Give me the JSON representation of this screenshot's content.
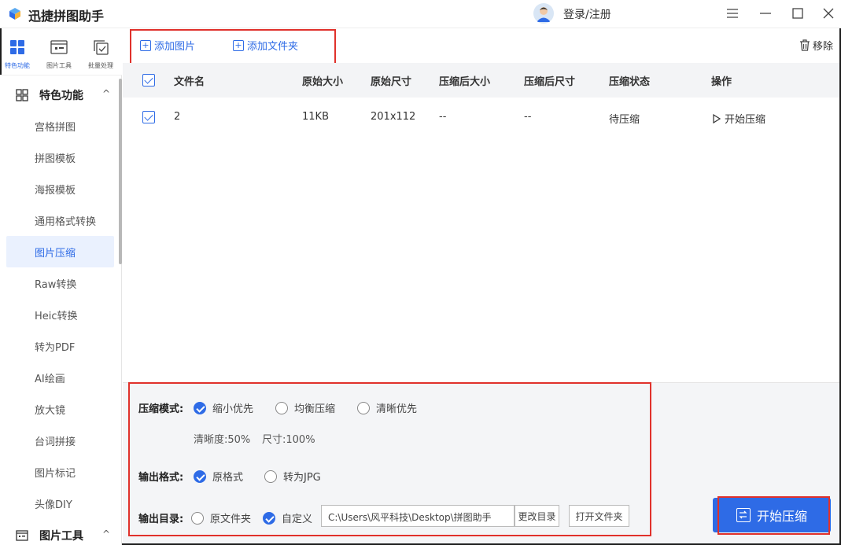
{
  "app": {
    "title": "迅捷拼图助手",
    "login": "登录/注册"
  },
  "topnav": [
    {
      "label": "特色功能",
      "icon": "grid-icon"
    },
    {
      "label": "图片工具",
      "icon": "image-tool-icon"
    },
    {
      "label": "批量处理",
      "icon": "batch-icon"
    }
  ],
  "sidebar": {
    "group1": "特色功能",
    "items": [
      "宫格拼图",
      "拼图模板",
      "海报模板",
      "通用格式转换",
      "图片压缩",
      "Raw转换",
      "Heic转换",
      "转为PDF",
      "AI绘画",
      "放大镜",
      "台词拼接",
      "图片标记",
      "头像DIY"
    ],
    "active_index": 4,
    "group2": "图片工具"
  },
  "toolbar": {
    "add_image": "添加图片",
    "add_folder": "添加文件夹",
    "remove": "移除"
  },
  "table": {
    "headers": [
      "文件名",
      "原始大小",
      "原始尺寸",
      "压缩后大小",
      "压缩后尺寸",
      "压缩状态",
      "操作"
    ],
    "rows": [
      {
        "name": "2",
        "size": "11KB",
        "dims": "201x112",
        "new_size": "--",
        "new_dims": "--",
        "status": "待压缩",
        "action": "开始压缩"
      }
    ]
  },
  "settings": {
    "mode_label": "压缩模式:",
    "mode_options": [
      "缩小优先",
      "均衡压缩",
      "清晰优先"
    ],
    "mode_selected": 0,
    "clarity": "清晰度:50%",
    "size": "尺寸:100%",
    "format_label": "输出格式:",
    "format_options": [
      "原格式",
      "转为JPG"
    ],
    "format_selected": 0,
    "dir_label": "输出目录:",
    "dir_options": [
      "原文件夹",
      "自定义"
    ],
    "dir_selected": 1,
    "path": "C:\\Users\\风平科技\\Desktop\\拼图助手",
    "change_dir": "更改目录",
    "open_folder": "打开文件夹",
    "start": "开始压缩"
  },
  "colors": {
    "accent": "#2e6be6",
    "highlight": "#e0312b"
  }
}
